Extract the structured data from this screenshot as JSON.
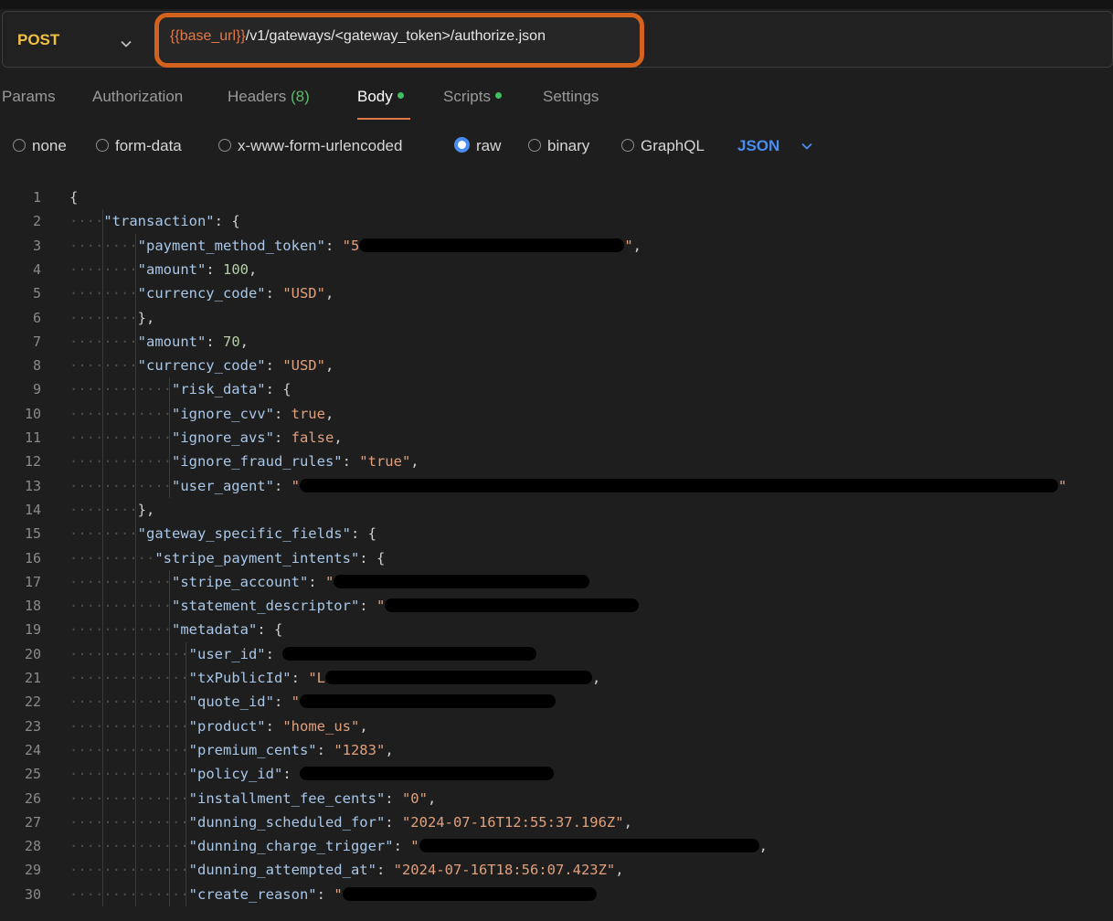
{
  "request": {
    "method": "POST",
    "url_variable": "{{base_url}}",
    "url_path": "/v1/gateways/<gateway_token>/authorize.json"
  },
  "tabs": [
    {
      "label": "Params"
    },
    {
      "label": "Authorization"
    },
    {
      "label": "Headers",
      "count": "(8)"
    },
    {
      "label": "Body",
      "active": true,
      "dot": true
    },
    {
      "label": "Scripts",
      "dot": true
    },
    {
      "label": "Settings"
    }
  ],
  "body_options": [
    "none",
    "form-data",
    "x-www-form-urlencoded",
    "raw",
    "binary",
    "GraphQL"
  ],
  "selected_body_option": "raw",
  "body_format": "JSON",
  "colors": {
    "accent": "#d3621f",
    "method": "#f0c040",
    "link": "#4a8df0",
    "dot": "#3fbf5f"
  },
  "code_lines": [
    {
      "n": "1",
      "indent": 0,
      "tokens": [
        [
          "punc",
          "{"
        ]
      ]
    },
    {
      "n": "2",
      "indent": 1,
      "tokens": [
        [
          "key",
          "\"transaction\""
        ],
        [
          "punc",
          ": {"
        ]
      ]
    },
    {
      "n": "3",
      "indent": 2,
      "tokens": [
        [
          "key",
          "\"payment_method_token\""
        ],
        [
          "punc",
          ": "
        ],
        [
          "str",
          "\"5"
        ],
        [
          "redact",
          "290"
        ],
        [
          "str",
          "\""
        ],
        [
          "punc",
          ","
        ]
      ]
    },
    {
      "n": "4",
      "indent": 2,
      "tokens": [
        [
          "key",
          "\"amount\""
        ],
        [
          "punc",
          ": "
        ],
        [
          "num",
          "100"
        ],
        [
          "punc",
          ","
        ]
      ]
    },
    {
      "n": "5",
      "indent": 2,
      "tokens": [
        [
          "key",
          "\"currency_code\""
        ],
        [
          "punc",
          ": "
        ],
        [
          "str",
          "\"USD\""
        ],
        [
          "punc",
          ","
        ]
      ]
    },
    {
      "n": "6",
      "indent": 2,
      "tokens": [
        [
          "punc",
          "},"
        ]
      ]
    },
    {
      "n": "7",
      "indent": 2,
      "tokens": [
        [
          "key",
          "\"amount\""
        ],
        [
          "punc",
          ": "
        ],
        [
          "num",
          "70"
        ],
        [
          "punc",
          ","
        ]
      ]
    },
    {
      "n": "8",
      "indent": 2,
      "tokens": [
        [
          "key",
          "\"currency_code\""
        ],
        [
          "punc",
          ": "
        ],
        [
          "str",
          "\"USD\""
        ],
        [
          "punc",
          ","
        ]
      ]
    },
    {
      "n": "9",
      "indent": 3,
      "tokens": [
        [
          "key",
          "\"risk_data\""
        ],
        [
          "punc",
          ": {"
        ]
      ]
    },
    {
      "n": "10",
      "indent": 3,
      "tokens": [
        [
          "key",
          "\"ignore_cvv\""
        ],
        [
          "punc",
          ": "
        ],
        [
          "kw",
          "true"
        ],
        [
          "punc",
          ","
        ]
      ]
    },
    {
      "n": "11",
      "indent": 3,
      "tokens": [
        [
          "key",
          "\"ignore_avs\""
        ],
        [
          "punc",
          ": "
        ],
        [
          "kw",
          "false"
        ],
        [
          "punc",
          ","
        ]
      ]
    },
    {
      "n": "12",
      "indent": 3,
      "tokens": [
        [
          "key",
          "\"ignore_fraud_rules\""
        ],
        [
          "punc",
          ": "
        ],
        [
          "str",
          "\"true\""
        ],
        [
          "punc",
          ","
        ]
      ]
    },
    {
      "n": "13",
      "indent": 3,
      "tokens": [
        [
          "key",
          "\"user_agent\""
        ],
        [
          "punc",
          ": "
        ],
        [
          "str",
          "\""
        ],
        [
          "redact",
          "830"
        ],
        [
          "str",
          "\""
        ]
      ]
    },
    {
      "n": "14",
      "indent": 2,
      "tokens": [
        [
          "punc",
          "},"
        ]
      ]
    },
    {
      "n": "15",
      "indent": 2,
      "tokens": [
        [
          "key",
          "\"gateway_specific_fields\""
        ],
        [
          "punc",
          ": {"
        ]
      ]
    },
    {
      "n": "16",
      "indent": 2.5,
      "tokens": [
        [
          "key",
          "\"stripe_payment_intents\""
        ],
        [
          "punc",
          ": {"
        ]
      ]
    },
    {
      "n": "17",
      "indent": 3,
      "tokens": [
        [
          "key",
          "\"stripe_account\""
        ],
        [
          "punc",
          ": "
        ],
        [
          "str",
          "\""
        ],
        [
          "redact",
          "280"
        ]
      ]
    },
    {
      "n": "18",
      "indent": 3,
      "tokens": [
        [
          "key",
          "\"statement_descriptor\""
        ],
        [
          "punc",
          ": "
        ],
        [
          "str",
          "\""
        ],
        [
          "redact",
          "278"
        ]
      ]
    },
    {
      "n": "19",
      "indent": 3,
      "tokens": [
        [
          "key",
          "\"metadata\""
        ],
        [
          "punc",
          ": {"
        ]
      ]
    },
    {
      "n": "20",
      "indent": 3.5,
      "tokens": [
        [
          "key",
          "\"user_id\""
        ],
        [
          "punc",
          ": "
        ],
        [
          "redact",
          "278"
        ]
      ]
    },
    {
      "n": "21",
      "indent": 3.5,
      "tokens": [
        [
          "key",
          "\"txPublicId\""
        ],
        [
          "punc",
          ": "
        ],
        [
          "str",
          "\"L"
        ],
        [
          "redact",
          "292"
        ],
        [
          "punc",
          ","
        ]
      ]
    },
    {
      "n": "22",
      "indent": 3.5,
      "tokens": [
        [
          "key",
          "\"quote_id\""
        ],
        [
          "punc",
          ": "
        ],
        [
          "str",
          "\""
        ],
        [
          "redact",
          "280"
        ]
      ]
    },
    {
      "n": "23",
      "indent": 3.5,
      "tokens": [
        [
          "key",
          "\"product\""
        ],
        [
          "punc",
          ": "
        ],
        [
          "str",
          "\"home_us\""
        ],
        [
          "punc",
          ","
        ]
      ]
    },
    {
      "n": "24",
      "indent": 3.5,
      "tokens": [
        [
          "key",
          "\"premium_cents\""
        ],
        [
          "punc",
          ": "
        ],
        [
          "str",
          "\"1283\""
        ],
        [
          "punc",
          ","
        ]
      ]
    },
    {
      "n": "25",
      "indent": 3.5,
      "tokens": [
        [
          "key",
          "\"policy_id\""
        ],
        [
          "punc",
          ": "
        ],
        [
          "redact",
          "278"
        ]
      ]
    },
    {
      "n": "26",
      "indent": 3.5,
      "tokens": [
        [
          "key",
          "\"installment_fee_cents\""
        ],
        [
          "punc",
          ": "
        ],
        [
          "str",
          "\"0\""
        ],
        [
          "punc",
          ","
        ]
      ]
    },
    {
      "n": "27",
      "indent": 3.5,
      "tokens": [
        [
          "key",
          "\"dunning_scheduled_for\""
        ],
        [
          "punc",
          ": "
        ],
        [
          "str",
          "\"2024-07-16T12:55:37.196Z\""
        ],
        [
          "punc",
          ","
        ]
      ]
    },
    {
      "n": "28",
      "indent": 3.5,
      "tokens": [
        [
          "key",
          "\"dunning_charge_trigger\""
        ],
        [
          "punc",
          ": "
        ],
        [
          "str",
          "\""
        ],
        [
          "redact",
          "372"
        ],
        [
          "punc",
          ","
        ]
      ]
    },
    {
      "n": "29",
      "indent": 3.5,
      "tokens": [
        [
          "key",
          "\"dunning_attempted_at\""
        ],
        [
          "punc",
          ": "
        ],
        [
          "str",
          "\"2024-07-16T18:56:07.423Z\""
        ],
        [
          "punc",
          ","
        ]
      ]
    },
    {
      "n": "30",
      "indent": 3.5,
      "tokens": [
        [
          "key",
          "\"create_reason\""
        ],
        [
          "punc",
          ": "
        ],
        [
          "str",
          "\""
        ],
        [
          "redact",
          "278"
        ]
      ]
    }
  ]
}
